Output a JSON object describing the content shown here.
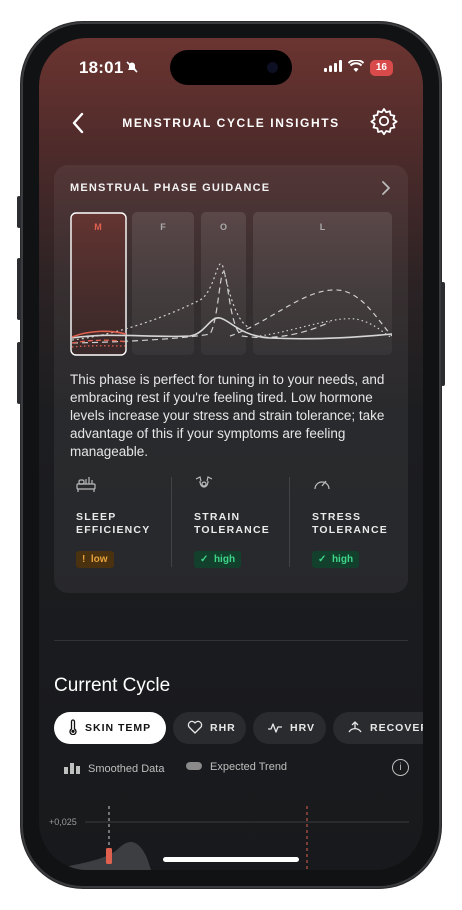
{
  "status_bar": {
    "time": "18:01",
    "battery": "16",
    "icons": [
      "bell-slash-icon",
      "signal-icon",
      "wifi-icon",
      "battery-icon"
    ]
  },
  "header": {
    "title": "MENSTRUAL CYCLE INSIGHTS",
    "back_icon": "chevron-left-icon",
    "settings_icon": "gear-icon"
  },
  "guidance": {
    "title": "MENSTRUAL PHASE GUIDANCE",
    "phases": [
      {
        "label": "M",
        "selected": true
      },
      {
        "label": "F",
        "selected": false
      },
      {
        "label": "O",
        "selected": false
      },
      {
        "label": "L",
        "selected": false
      }
    ],
    "description": "This phase is perfect for tuning in to your needs, and embracing rest if you're feeling tired. Low hormone levels increase your stress and strain tolerance; take advantage of this if your symptoms are feeling manageable.",
    "metrics": [
      {
        "label_line1": "SLEEP",
        "label_line2": "EFFICIENCY",
        "badge_symbol": "!",
        "badge_text": "low",
        "status": "low",
        "icon": "bed-icon"
      },
      {
        "label_line1": "STRAIN",
        "label_line2": "TOLERANCE",
        "badge_symbol": "✓",
        "badge_text": "high",
        "status": "high",
        "icon": "strain-icon"
      },
      {
        "label_line1": "STRESS",
        "label_line2": "TOLERANCE",
        "badge_symbol": "✓",
        "badge_text": "high",
        "status": "high",
        "icon": "gauge-icon"
      }
    ]
  },
  "current_cycle": {
    "title": "Current Cycle",
    "tabs": [
      {
        "label": "SKIN TEMP",
        "icon": "thermometer-icon",
        "active": true
      },
      {
        "label": "RHR",
        "icon": "heart-icon",
        "active": false
      },
      {
        "label": "HRV",
        "icon": "hrv-icon",
        "active": false
      },
      {
        "label": "RECOVERY",
        "icon": "recovery-icon",
        "active": false
      }
    ],
    "legend": {
      "smoothed": "Smoothed Data",
      "expected": "Expected Trend",
      "info_icon": "info-icon"
    },
    "y_tick": "+0,025"
  },
  "colors": {
    "accent": "#e0604f",
    "low": "#e7a23c",
    "high": "#3fd68a"
  }
}
